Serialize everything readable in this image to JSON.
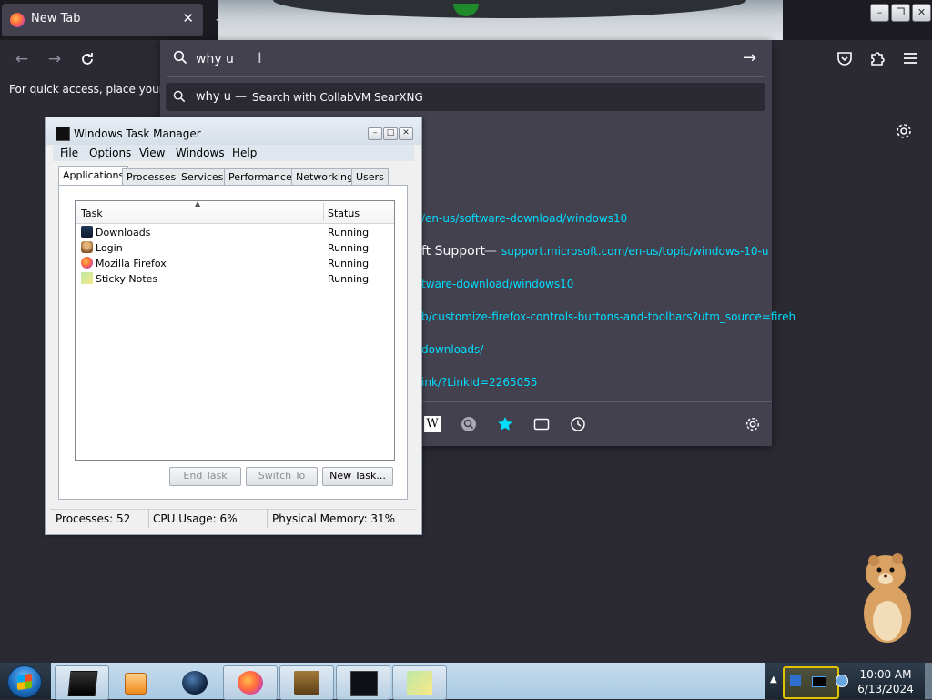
{
  "browser": {
    "tab_title": "New Tab",
    "tab_close": "✕",
    "new_tab": "+",
    "bookmarks_message": "For quick access, place your bo",
    "window_controls": [
      "–",
      "❐",
      "✕"
    ]
  },
  "urlbar": {
    "query": "why u",
    "suggestion": {
      "query": "why u",
      "dash": "—",
      "action": "Search with CollabVM SearXNG"
    },
    "results": [
      {
        "title": "",
        "link": "/en-us/software-download/windows10"
      },
      {
        "title": "ft Support",
        "dash": "—",
        "link": "support.microsoft.com/en-us/topic/windows-10-u"
      },
      {
        "title": "",
        "link": "tware-download/windows10"
      },
      {
        "title": "",
        "link": "b/customize-firefox-controls-buttons-and-toolbars?utm_source=fireh"
      },
      {
        "title": "",
        "link": "downloads/"
      },
      {
        "title": "",
        "link": "ink/?LinkId=2265055"
      }
    ],
    "shortcut_icons": [
      "wikipedia-icon",
      "search-engine-icon",
      "bookmarks-star-icon",
      "tabs-icon",
      "history-icon",
      "settings-gear-icon"
    ]
  },
  "task_manager": {
    "title": "Windows Task Manager",
    "window_buttons": [
      "–",
      "□",
      "✕"
    ],
    "menu": [
      "File",
      "Options",
      "View",
      "Windows",
      "Help"
    ],
    "tabs": [
      "Applications",
      "Processes",
      "Services",
      "Performance",
      "Networking",
      "Users"
    ],
    "active_tab": "Applications",
    "columns": {
      "task": "Task",
      "status": "Status"
    },
    "rows": [
      {
        "task": "Downloads",
        "status": "Running"
      },
      {
        "task": "Login",
        "status": "Running"
      },
      {
        "task": "Mozilla Firefox",
        "status": "Running"
      },
      {
        "task": "Sticky Notes",
        "status": "Running"
      }
    ],
    "buttons": {
      "end_task": "End Task",
      "switch_to": "Switch To",
      "new_task": "New Task..."
    },
    "status_bar": {
      "processes": "Processes: 52",
      "cpu": "CPU Usage: 6%",
      "memory": "Physical Memory: 31%"
    }
  },
  "taskbar": {
    "clock_time": "10:00 AM",
    "clock_date": "6/13/2024",
    "app_icons": [
      "terminal-icon",
      "media-player-icon",
      "globe-icon",
      "firefox-icon",
      "box-game-icon",
      "task-manager-icon",
      "sticky-notes-icon"
    ]
  },
  "colors": {
    "firefox_bg": "#2b2a33",
    "urlbar_bg": "#42414d",
    "link_cyan": "#00ddff",
    "taskbar_blue": "#b7cfe3"
  }
}
